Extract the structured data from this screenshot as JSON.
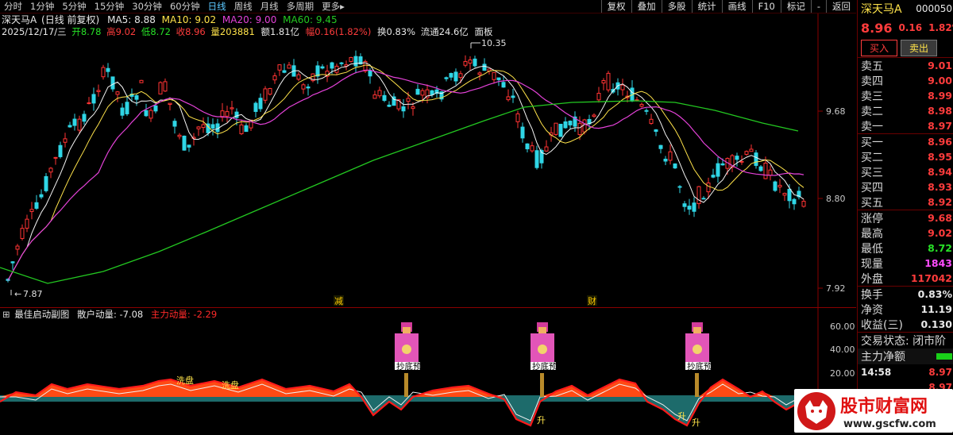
{
  "toolbar": {
    "periods": [
      "分时",
      "1分钟",
      "5分钟",
      "15分钟",
      "30分钟",
      "60分钟",
      "日线",
      "周线",
      "月线",
      "多周期"
    ],
    "active_period": "日线",
    "more": "更多",
    "more_arrow": "▸",
    "right_buttons": [
      "复权",
      "叠加",
      "多股",
      "统计",
      "画线",
      "F10",
      "标记",
      "-",
      "返回"
    ]
  },
  "main": {
    "stock_name": "深天马A",
    "mode": "(日线 前复权)",
    "ma5": "MA5: 8.88",
    "ma10": "MA10: 9.02",
    "ma20": "MA20: 9.00",
    "ma60": "MA60: 9.45",
    "date": "2025/12/17/三",
    "open_label": "开",
    "open": "8.78",
    "high_label": "高",
    "high": "9.02",
    "low_label": "低",
    "low": "8.72",
    "close_label": "收",
    "close": "8.96",
    "vol_label": "量",
    "vol": "203881",
    "amount": "额1.81亿",
    "chg": "幅0.16(1.82%)",
    "turnover": "换0.83%",
    "float_cap": "流通24.6亿",
    "panel": "面板",
    "price_high_label": "10.35",
    "price_low_label": "7.87",
    "yaxis": [
      "9.68",
      "8.80",
      "7.92"
    ],
    "markers": [
      "减",
      "财"
    ]
  },
  "indicator": {
    "name": "最佳启动副图",
    "retail": "散户动量: -7.08",
    "main_force": "主力动量: -2.29",
    "yaxis": [
      "60.00",
      "40.00",
      "20.00"
    ],
    "labels": [
      "洗盘",
      "洗盘"
    ],
    "warn": "抄底预警！",
    "up": "升"
  },
  "side": {
    "name": "深天马A",
    "code": "000050",
    "price": "8.96",
    "change": "0.16",
    "pct": "1.82%",
    "buy_btn": "买入",
    "sell_btn": "卖出",
    "asks": [
      {
        "label": "卖五",
        "val": "9.01"
      },
      {
        "label": "卖四",
        "val": "9.00"
      },
      {
        "label": "卖三",
        "val": "8.99"
      },
      {
        "label": "卖二",
        "val": "8.98"
      },
      {
        "label": "卖一",
        "val": "8.97"
      }
    ],
    "bids": [
      {
        "label": "买一",
        "val": "8.96"
      },
      {
        "label": "买二",
        "val": "8.95"
      },
      {
        "label": "买三",
        "val": "8.94"
      },
      {
        "label": "买四",
        "val": "8.93"
      },
      {
        "label": "买五",
        "val": "8.92"
      }
    ],
    "stats": [
      {
        "label": "涨停",
        "val": "9.68",
        "cls": "red"
      },
      {
        "label": "最高",
        "val": "9.02",
        "cls": "red"
      },
      {
        "label": "最低",
        "val": "8.72",
        "cls": "green"
      },
      {
        "label": "现量",
        "val": "1843",
        "cls": "mag"
      },
      {
        "label": "外盘",
        "val": "117042",
        "cls": "red"
      }
    ],
    "stats2": [
      {
        "label": "换手",
        "val": "0.83%"
      },
      {
        "label": "净资",
        "val": "11.19"
      },
      {
        "label": "收益(三)",
        "val": "0.130"
      }
    ],
    "status": "交易状态: 闭市阶",
    "net_label": "主力净额",
    "tick_time": "14:58",
    "tick_p1": "8.97",
    "tick_p2": "8.97"
  },
  "watermark": {
    "title": "股市财富网",
    "url": "www.gscfw.com"
  }
}
